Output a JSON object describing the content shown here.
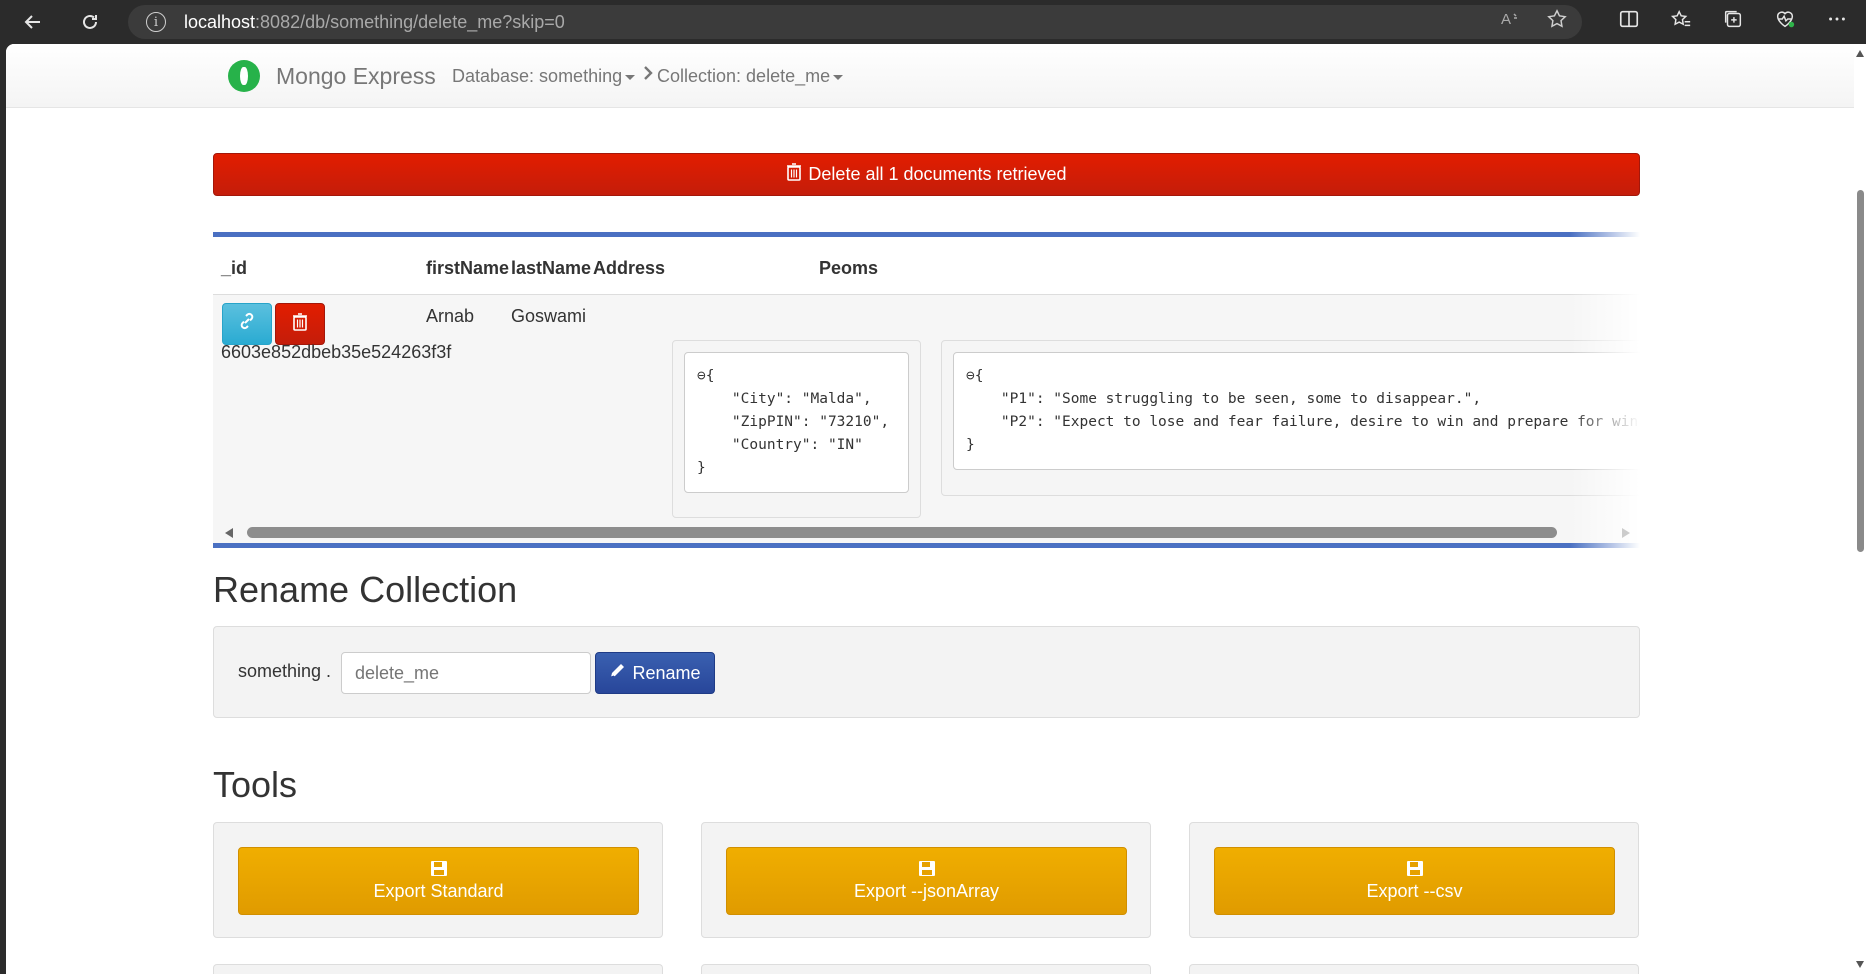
{
  "browser": {
    "url_host": "localhost",
    "url_rest": ":8082/db/something/delete_me?skip=0"
  },
  "navbar": {
    "brand": "Mongo Express",
    "database_crumb": "Database: something",
    "collection_crumb": "Collection: delete_me"
  },
  "delete_all_label": "Delete all 1 documents retrieved",
  "table": {
    "headers": [
      "_id",
      "firstName",
      "lastName",
      "Address",
      "Peoms"
    ],
    "row": {
      "id": "6603e852dbeb35e524263f3f",
      "firstName": "Arnab",
      "lastName": "Goswami",
      "address_json": "⊖{\n    \"City\": \"Malda\",\n    \"ZipPIN\": \"73210\",\n    \"Country\": \"IN\"\n}",
      "peoms_json": "⊖{\n    \"P1\": \"Some struggling to be seen, some to disappear.\",\n    \"P2\": \"Expect to lose and fear failure, desire to win and prepare for win\"\n}"
    }
  },
  "rename": {
    "title": "Rename Collection",
    "db_label": "something .",
    "placeholder": "delete_me",
    "button_label": "Rename"
  },
  "tools": {
    "title": "Tools",
    "buttons": [
      {
        "label": "Export Standard"
      },
      {
        "label": "Export --jsonArray"
      },
      {
        "label": "Export --csv"
      }
    ]
  },
  "colors": {
    "danger": "#c9302c",
    "primary": "#2e4e9e",
    "warning": "#eba800",
    "info": "#2aabd2",
    "table_border": "#4a70c2"
  }
}
